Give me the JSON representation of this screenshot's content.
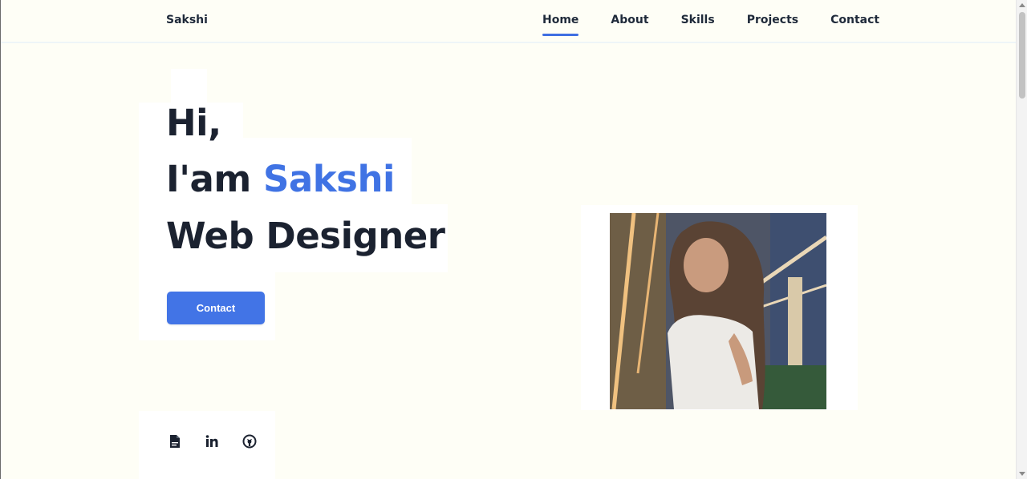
{
  "header": {
    "logo": "Sakshi",
    "nav": [
      {
        "label": "Home",
        "active": true
      },
      {
        "label": "About",
        "active": false
      },
      {
        "label": "Skills",
        "active": false
      },
      {
        "label": "Projects",
        "active": false
      },
      {
        "label": "Contact",
        "active": false
      }
    ]
  },
  "hero": {
    "line1": "Hi,",
    "line2_prefix": "I'am ",
    "line2_name": "Sakshi",
    "line3": "Web Designer",
    "button_label": "Contact"
  },
  "socials": [
    {
      "icon": "document-icon"
    },
    {
      "icon": "linkedin-icon"
    },
    {
      "icon": "github-icon"
    }
  ],
  "photo": {
    "icon": "portrait-photo"
  },
  "colors": {
    "accent": "#4073e4",
    "background": "#fefef6",
    "text": "#1b2230"
  }
}
